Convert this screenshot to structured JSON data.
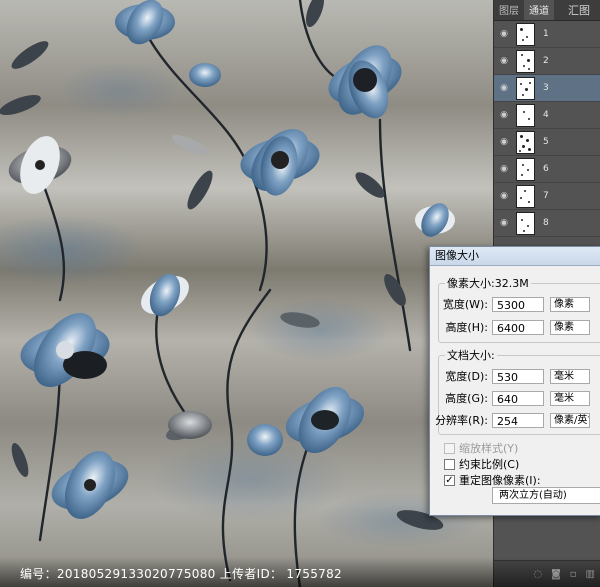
{
  "panel": {
    "tabs": [
      "图层",
      "通道"
    ],
    "layers": [
      {
        "name": "1",
        "selected": false
      },
      {
        "name": "2",
        "selected": false
      },
      {
        "name": "3",
        "selected": true
      },
      {
        "name": "4",
        "selected": false
      },
      {
        "name": "5",
        "selected": false
      },
      {
        "name": "6",
        "selected": false
      },
      {
        "name": "7",
        "selected": false
      },
      {
        "name": "8",
        "selected": false
      }
    ],
    "footer_icons": [
      "link-icon",
      "fx-icon",
      "mask-icon",
      "adjustment-icon",
      "folder-icon",
      "new-layer-icon",
      "trash-icon"
    ]
  },
  "dialog": {
    "title": "图像大小",
    "pixel_dimensions": {
      "legend": "像素大小:32.3M",
      "width_label": "宽度(W):",
      "width_value": "5300",
      "width_unit": "像素",
      "height_label": "高度(H):",
      "height_value": "6400",
      "height_unit": "像素"
    },
    "document_size": {
      "legend": "文档大小:",
      "width_label": "宽度(D):",
      "width_value": "530",
      "width_unit": "毫米",
      "height_label": "高度(G):",
      "height_value": "640",
      "height_unit": "毫米",
      "resolution_label": "分辨率(R):",
      "resolution_value": "254",
      "resolution_unit": "像素/英寸"
    },
    "scale_styles": "缩放样式(Y)",
    "constrain_proportions": "约束比例(C)",
    "resample": "重定图像像素(I):",
    "resample_method": "两次立方(自动)"
  },
  "watermark": {
    "text": "编号：20180529133020775080 上传者ID： 1755782",
    "logo": "汇图"
  },
  "colors": {
    "panel_bg": "#535353",
    "selected_layer": "#5f7285",
    "flower_blue": "#5f86ad"
  }
}
